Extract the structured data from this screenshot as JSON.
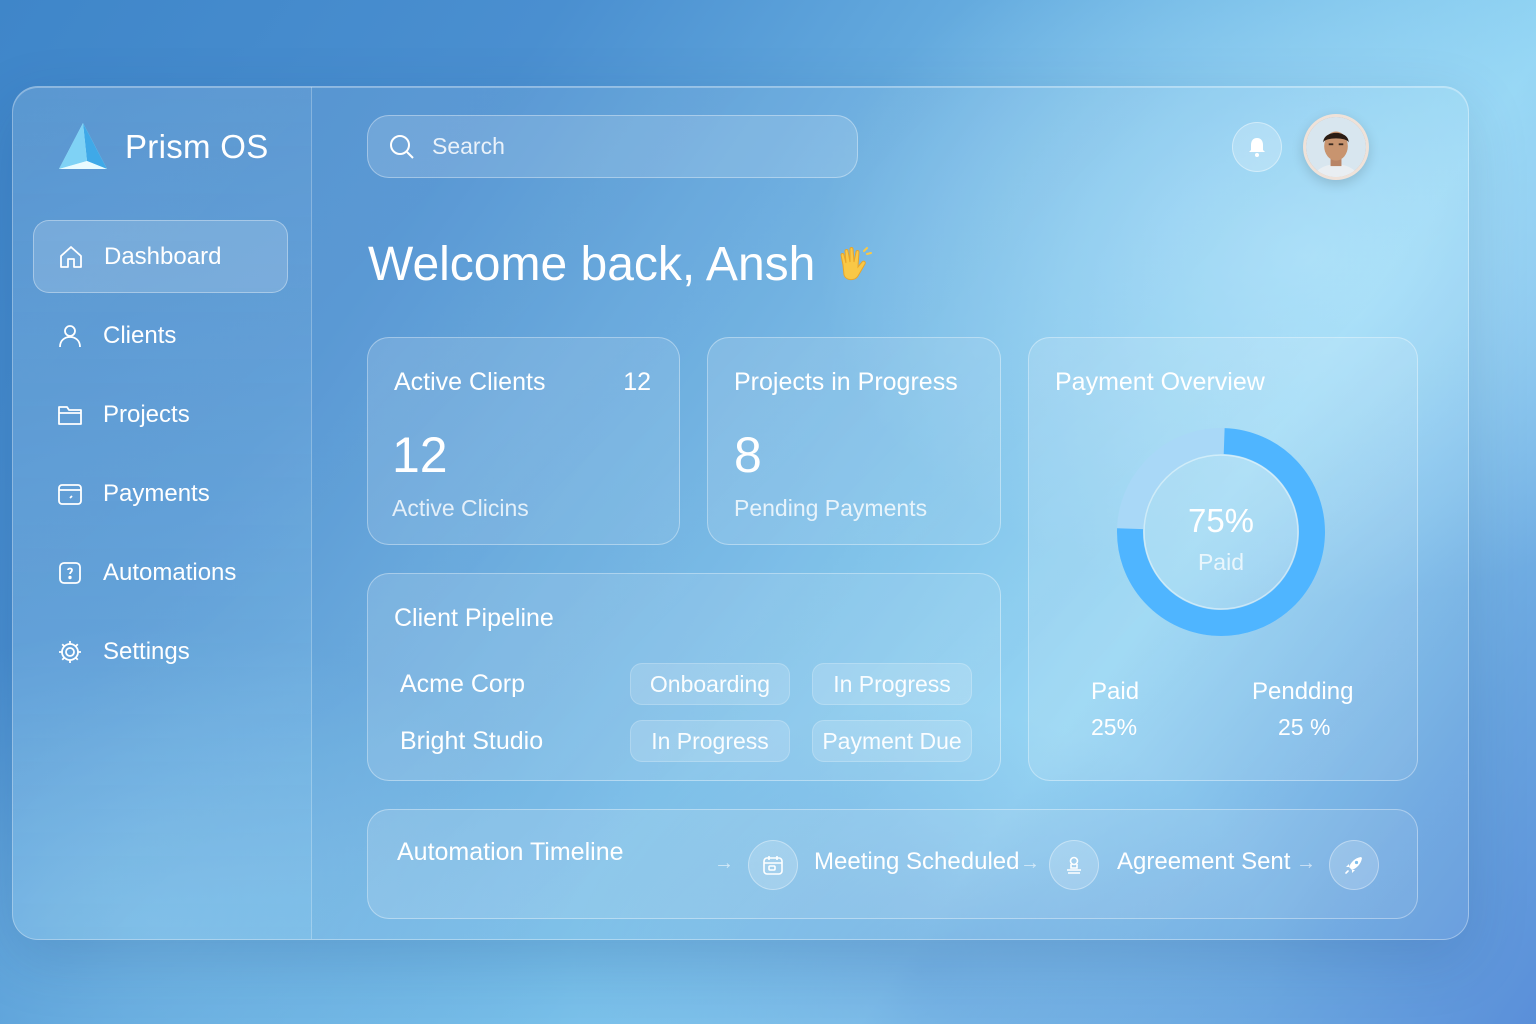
{
  "app": {
    "name": "Prism OS"
  },
  "sidebar": {
    "items": [
      {
        "label": "Dashboard",
        "icon": "home-icon"
      },
      {
        "label": "Clients",
        "icon": "user-icon"
      },
      {
        "label": "Projects",
        "icon": "folder-icon"
      },
      {
        "label": "Payments",
        "icon": "wallet-icon"
      },
      {
        "label": "Automations",
        "icon": "automation-icon"
      },
      {
        "label": "Settings",
        "icon": "gear-icon"
      }
    ],
    "active": "Dashboard"
  },
  "header": {
    "search_placeholder": "Search",
    "notification_icon": "bell-icon",
    "avatar": "user-avatar"
  },
  "welcome": {
    "text": "Welcome back, Ansh",
    "emoji_icon": "waving-hand-icon"
  },
  "cards": {
    "active_clients": {
      "title": "Active Clients",
      "badge": "12",
      "value": "12",
      "subtitle": "Active Clicins"
    },
    "projects": {
      "title": "Projects in Progress",
      "value": "8",
      "subtitle": "Pending Payments"
    }
  },
  "pipeline": {
    "title": "Client Pipeline",
    "rows": [
      {
        "client": "Acme Corp",
        "stages": [
          "Onboarding",
          "In Progress"
        ]
      },
      {
        "client": "Bright Studio",
        "stages": [
          "In Progress",
          "Payment Due"
        ]
      }
    ]
  },
  "payment_overview": {
    "title": "Payment Overview",
    "donut_percent": 75,
    "donut_label": "75%",
    "donut_sub": "Paid",
    "stats": [
      {
        "label": "Paid",
        "value": "25%"
      },
      {
        "label": "Pendding",
        "value": "25 %"
      }
    ]
  },
  "timeline": {
    "title": "Automation Timeline",
    "steps": [
      {
        "label": "Meeting Scheduled",
        "icon": "calendar-icon"
      },
      {
        "label": "Agreement Sent",
        "icon": "stamp-icon"
      },
      {
        "label": "",
        "icon": "rocket-icon"
      }
    ]
  },
  "colors": {
    "accent": "#4fb5ff",
    "donut_track": "#9fd3f7"
  }
}
